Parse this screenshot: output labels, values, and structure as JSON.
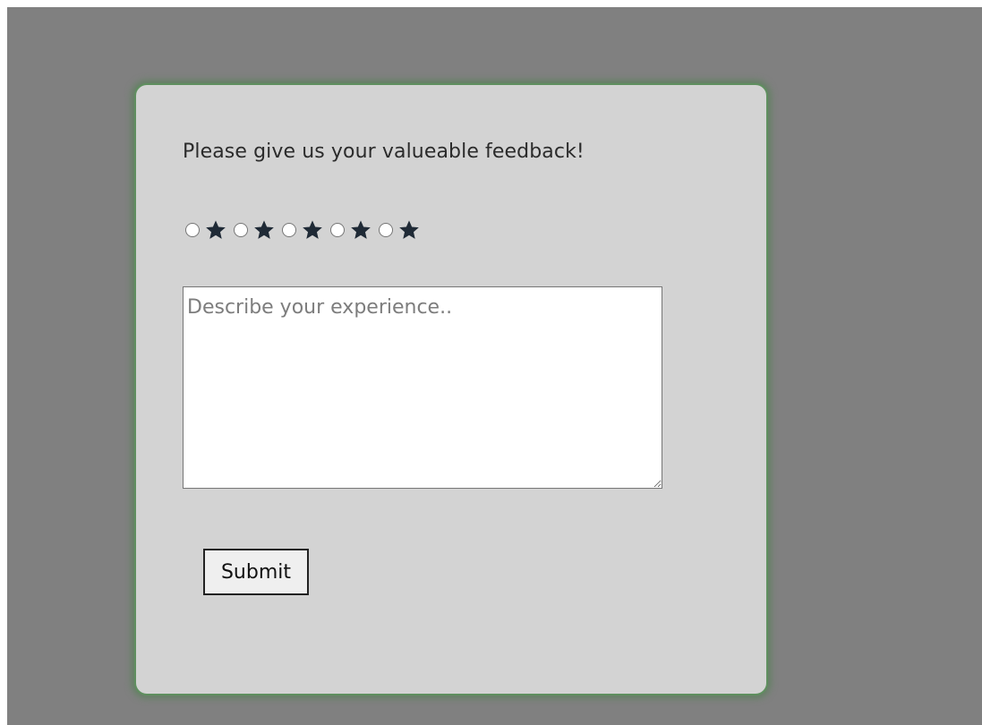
{
  "form": {
    "prompt": "Please give us your valueable feedback!",
    "rating": {
      "options": [
        {
          "icon": "star-icon"
        },
        {
          "icon": "star-icon"
        },
        {
          "icon": "star-icon"
        },
        {
          "icon": "star-icon"
        },
        {
          "icon": "star-icon"
        }
      ],
      "selected": null
    },
    "comment": {
      "placeholder": "Describe your experience..",
      "value": ""
    },
    "submit_label": "Submit"
  },
  "colors": {
    "page_background": "#808080",
    "card_background": "#d3d3d3",
    "card_glow": "#5f8f5f",
    "star": "#1f2a36"
  }
}
